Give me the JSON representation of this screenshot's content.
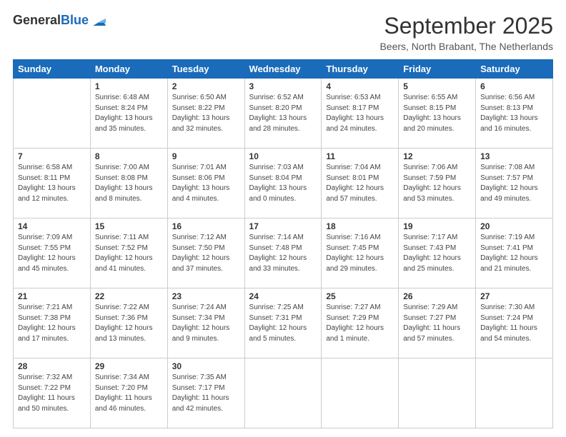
{
  "header": {
    "logo_general": "General",
    "logo_blue": "Blue",
    "month_title": "September 2025",
    "location": "Beers, North Brabant, The Netherlands"
  },
  "days_of_week": [
    "Sunday",
    "Monday",
    "Tuesday",
    "Wednesday",
    "Thursday",
    "Friday",
    "Saturday"
  ],
  "weeks": [
    [
      {
        "day": "",
        "info": ""
      },
      {
        "day": "1",
        "info": "Sunrise: 6:48 AM\nSunset: 8:24 PM\nDaylight: 13 hours\nand 35 minutes."
      },
      {
        "day": "2",
        "info": "Sunrise: 6:50 AM\nSunset: 8:22 PM\nDaylight: 13 hours\nand 32 minutes."
      },
      {
        "day": "3",
        "info": "Sunrise: 6:52 AM\nSunset: 8:20 PM\nDaylight: 13 hours\nand 28 minutes."
      },
      {
        "day": "4",
        "info": "Sunrise: 6:53 AM\nSunset: 8:17 PM\nDaylight: 13 hours\nand 24 minutes."
      },
      {
        "day": "5",
        "info": "Sunrise: 6:55 AM\nSunset: 8:15 PM\nDaylight: 13 hours\nand 20 minutes."
      },
      {
        "day": "6",
        "info": "Sunrise: 6:56 AM\nSunset: 8:13 PM\nDaylight: 13 hours\nand 16 minutes."
      }
    ],
    [
      {
        "day": "7",
        "info": "Sunrise: 6:58 AM\nSunset: 8:11 PM\nDaylight: 13 hours\nand 12 minutes."
      },
      {
        "day": "8",
        "info": "Sunrise: 7:00 AM\nSunset: 8:08 PM\nDaylight: 13 hours\nand 8 minutes."
      },
      {
        "day": "9",
        "info": "Sunrise: 7:01 AM\nSunset: 8:06 PM\nDaylight: 13 hours\nand 4 minutes."
      },
      {
        "day": "10",
        "info": "Sunrise: 7:03 AM\nSunset: 8:04 PM\nDaylight: 13 hours\nand 0 minutes."
      },
      {
        "day": "11",
        "info": "Sunrise: 7:04 AM\nSunset: 8:01 PM\nDaylight: 12 hours\nand 57 minutes."
      },
      {
        "day": "12",
        "info": "Sunrise: 7:06 AM\nSunset: 7:59 PM\nDaylight: 12 hours\nand 53 minutes."
      },
      {
        "day": "13",
        "info": "Sunrise: 7:08 AM\nSunset: 7:57 PM\nDaylight: 12 hours\nand 49 minutes."
      }
    ],
    [
      {
        "day": "14",
        "info": "Sunrise: 7:09 AM\nSunset: 7:55 PM\nDaylight: 12 hours\nand 45 minutes."
      },
      {
        "day": "15",
        "info": "Sunrise: 7:11 AM\nSunset: 7:52 PM\nDaylight: 12 hours\nand 41 minutes."
      },
      {
        "day": "16",
        "info": "Sunrise: 7:12 AM\nSunset: 7:50 PM\nDaylight: 12 hours\nand 37 minutes."
      },
      {
        "day": "17",
        "info": "Sunrise: 7:14 AM\nSunset: 7:48 PM\nDaylight: 12 hours\nand 33 minutes."
      },
      {
        "day": "18",
        "info": "Sunrise: 7:16 AM\nSunset: 7:45 PM\nDaylight: 12 hours\nand 29 minutes."
      },
      {
        "day": "19",
        "info": "Sunrise: 7:17 AM\nSunset: 7:43 PM\nDaylight: 12 hours\nand 25 minutes."
      },
      {
        "day": "20",
        "info": "Sunrise: 7:19 AM\nSunset: 7:41 PM\nDaylight: 12 hours\nand 21 minutes."
      }
    ],
    [
      {
        "day": "21",
        "info": "Sunrise: 7:21 AM\nSunset: 7:38 PM\nDaylight: 12 hours\nand 17 minutes."
      },
      {
        "day": "22",
        "info": "Sunrise: 7:22 AM\nSunset: 7:36 PM\nDaylight: 12 hours\nand 13 minutes."
      },
      {
        "day": "23",
        "info": "Sunrise: 7:24 AM\nSunset: 7:34 PM\nDaylight: 12 hours\nand 9 minutes."
      },
      {
        "day": "24",
        "info": "Sunrise: 7:25 AM\nSunset: 7:31 PM\nDaylight: 12 hours\nand 5 minutes."
      },
      {
        "day": "25",
        "info": "Sunrise: 7:27 AM\nSunset: 7:29 PM\nDaylight: 12 hours\nand 1 minute."
      },
      {
        "day": "26",
        "info": "Sunrise: 7:29 AM\nSunset: 7:27 PM\nDaylight: 11 hours\nand 57 minutes."
      },
      {
        "day": "27",
        "info": "Sunrise: 7:30 AM\nSunset: 7:24 PM\nDaylight: 11 hours\nand 54 minutes."
      }
    ],
    [
      {
        "day": "28",
        "info": "Sunrise: 7:32 AM\nSunset: 7:22 PM\nDaylight: 11 hours\nand 50 minutes."
      },
      {
        "day": "29",
        "info": "Sunrise: 7:34 AM\nSunset: 7:20 PM\nDaylight: 11 hours\nand 46 minutes."
      },
      {
        "day": "30",
        "info": "Sunrise: 7:35 AM\nSunset: 7:17 PM\nDaylight: 11 hours\nand 42 minutes."
      },
      {
        "day": "",
        "info": ""
      },
      {
        "day": "",
        "info": ""
      },
      {
        "day": "",
        "info": ""
      },
      {
        "day": "",
        "info": ""
      }
    ]
  ]
}
